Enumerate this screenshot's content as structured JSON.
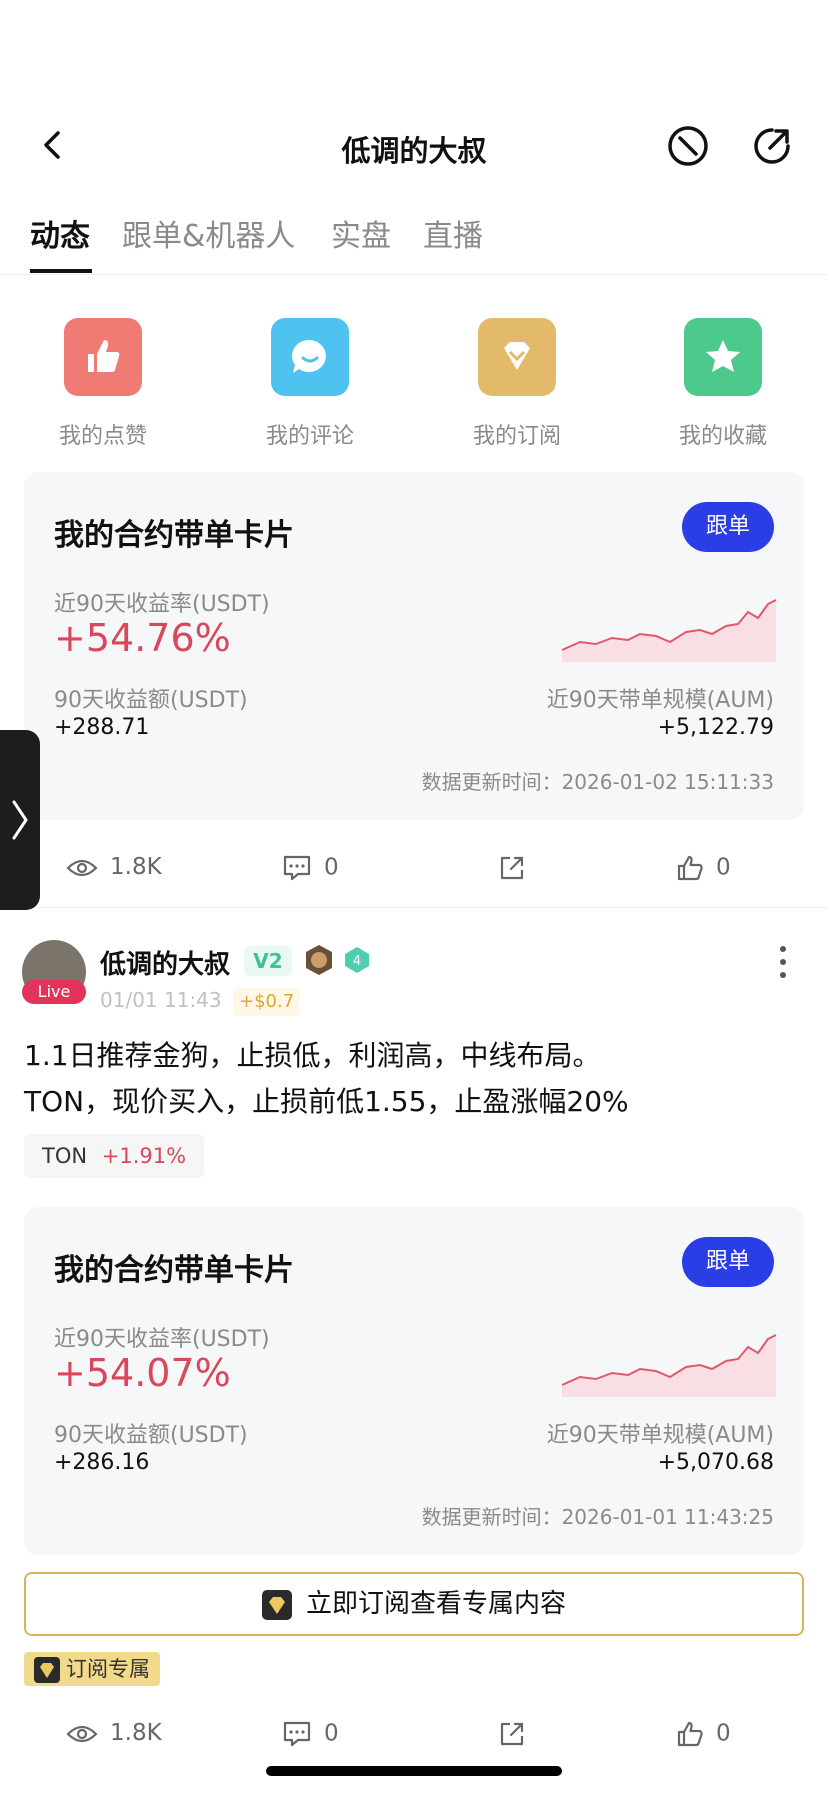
{
  "header": {
    "title": "低调的大叔",
    "back_icon": "chevron-left-icon",
    "right_icons": [
      "block-icon",
      "share-icon"
    ]
  },
  "tabs": [
    {
      "label": "动态",
      "active": true
    },
    {
      "label": "跟单&机器人",
      "active": false
    },
    {
      "label": "实盘",
      "active": false
    },
    {
      "label": "直播",
      "active": false
    }
  ],
  "quick_actions": [
    {
      "label": "我的点赞",
      "icon": "thumbs-up-icon",
      "color": "#f07b74"
    },
    {
      "label": "我的评论",
      "icon": "comment-icon",
      "color": "#4fc3f0"
    },
    {
      "label": "我的订阅",
      "icon": "diamond-icon",
      "color": "#e3b96a"
    },
    {
      "label": "我的收藏",
      "icon": "star-icon",
      "color": "#4cc98b"
    }
  ],
  "cards": [
    {
      "title": "我的合约带单卡片",
      "follow_label": "跟单",
      "roi_label": "近90天收益率(USDT)",
      "roi_value": "+54.76%",
      "pnl_label": "90天收益额(USDT)",
      "pnl_value": "+288.71",
      "aum_label": "近90天带单规模(AUM)",
      "aum_value": "+5,122.79",
      "updated": "数据更新时间：2026-01-02 15:11:33"
    },
    {
      "title": "我的合约带单卡片",
      "follow_label": "跟单",
      "roi_label": "近90天收益率(USDT)",
      "roi_value": "+54.07%",
      "pnl_label": "90天收益额(USDT)",
      "pnl_value": "+286.16",
      "aum_label": "近90天带单规模(AUM)",
      "aum_value": "+5,070.68",
      "updated": "数据更新时间：2026-01-01 11:43:25"
    }
  ],
  "stats": [
    {
      "views": "1.8K",
      "comments": "0",
      "likes": "0"
    },
    {
      "views": "1.8K",
      "comments": "0",
      "likes": "0"
    }
  ],
  "post": {
    "author": "低调的大叔",
    "live_label": "Live",
    "level_badge": "V2",
    "rank_badge": "4",
    "time": "01/01 11:43",
    "gain": "+$0.7",
    "line1": "1.1日推荐金狗，止损低，利润高，中线布局。",
    "line2": "TON，现价买入，止损前低1.55，止盈涨幅20%",
    "tag_symbol": "TON",
    "tag_change": "+1.91%"
  },
  "subscribe": {
    "button_label": "立即订阅查看专属内容",
    "exclusive_label": "订阅专属"
  },
  "colors": {
    "accent_blue": "#2b3ee6",
    "profit_red": "#d9485a",
    "gold": "#d9b25c"
  }
}
